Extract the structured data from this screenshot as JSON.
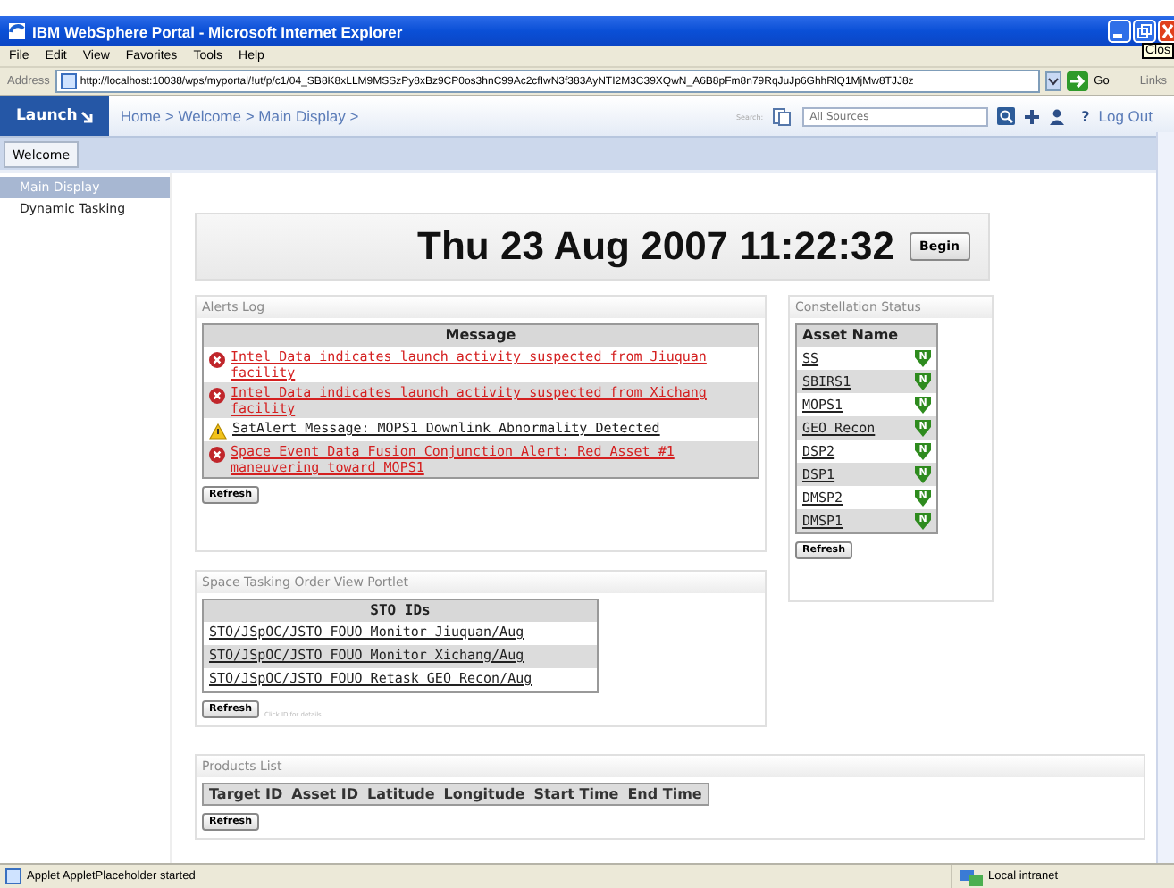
{
  "window": {
    "title": "IBM WebSphere Portal - Microsoft Internet Explorer",
    "tooltip": "Clos"
  },
  "menu": [
    "File",
    "Edit",
    "View",
    "Favorites",
    "Tools",
    "Help"
  ],
  "address": {
    "label": "Address",
    "url": "http://localhost:10038/wps/myportal/!ut/p/c1/04_SB8K8xLLM9MSSzPy8xBz9CP0os3hnC99Ac2cfIwN3f383AyNTI2M3C39XQwN_A6B8pFm8n79RqJuJp6GhhRlQ1MjMw8TJJ8z",
    "go": "Go",
    "links": "Links"
  },
  "portal": {
    "launch": "Launch",
    "breadcrumb": "Home > Welcome > Main Display >",
    "search_label": "Search:",
    "search_placeholder": "All Sources",
    "help": "?",
    "logout": "Log Out"
  },
  "tabs": [
    {
      "label": "Welcome",
      "selected": true
    }
  ],
  "nav": [
    {
      "label": "Main Display",
      "selected": true
    },
    {
      "label": "Dynamic Tasking",
      "selected": false
    }
  ],
  "clock": {
    "text": "Thu 23 Aug 2007 11:22:32",
    "button": "Begin"
  },
  "alerts": {
    "title": "Alerts Log",
    "column": "Message",
    "refresh": "Refresh",
    "rows": [
      {
        "kind": "error",
        "text": "Intel Data indicates launch activity suspected from Jiuquan facility"
      },
      {
        "kind": "error",
        "text": "Intel Data indicates launch activity suspected from Xichang facility"
      },
      {
        "kind": "warning",
        "text": "SatAlert Message: MOPS1 Downlink Abnormality Detected"
      },
      {
        "kind": "error",
        "text": "Space Event Data Fusion Conjunction Alert: Red Asset #1 maneuvering toward MOPS1"
      }
    ]
  },
  "constellation": {
    "title": "Constellation Status",
    "column": "Asset Name",
    "refresh": "Refresh",
    "rows": [
      {
        "name": "SS",
        "status": "N",
        "color": "#2e8b1e"
      },
      {
        "name": "SBIRS1",
        "status": "N",
        "color": "#2e8b1e"
      },
      {
        "name": "MOPS1",
        "status": "N",
        "color": "#2e8b1e"
      },
      {
        "name": "GEO_Recon",
        "status": "N",
        "color": "#2e8b1e"
      },
      {
        "name": "DSP2",
        "status": "N",
        "color": "#2e8b1e"
      },
      {
        "name": "DSP1",
        "status": "N",
        "color": "#2e8b1e"
      },
      {
        "name": "DMSP2",
        "status": "N",
        "color": "#2e8b1e"
      },
      {
        "name": "DMSP1",
        "status": "N",
        "color": "#2e8b1e"
      }
    ]
  },
  "sto": {
    "title": "Space Tasking Order View Portlet",
    "column": "STO IDs",
    "refresh": "Refresh",
    "hint": "Click ID for details",
    "rows": [
      "STO/JSpOC/JSTO FOUO Monitor Jiuquan/Aug",
      "STO/JSpOC/JSTO FOUO Monitor Xichang/Aug",
      "STO/JSpOC/JSTO FOUO Retask GEO Recon/Aug"
    ]
  },
  "products": {
    "title": "Products List",
    "columns": [
      "Target ID",
      "Asset ID",
      "Latitude",
      "Longitude",
      "Start Time",
      "End Time"
    ],
    "refresh": "Refresh"
  },
  "status_bar": {
    "text": "Applet AppletPlaceholder started",
    "zone": "Local intranet"
  }
}
